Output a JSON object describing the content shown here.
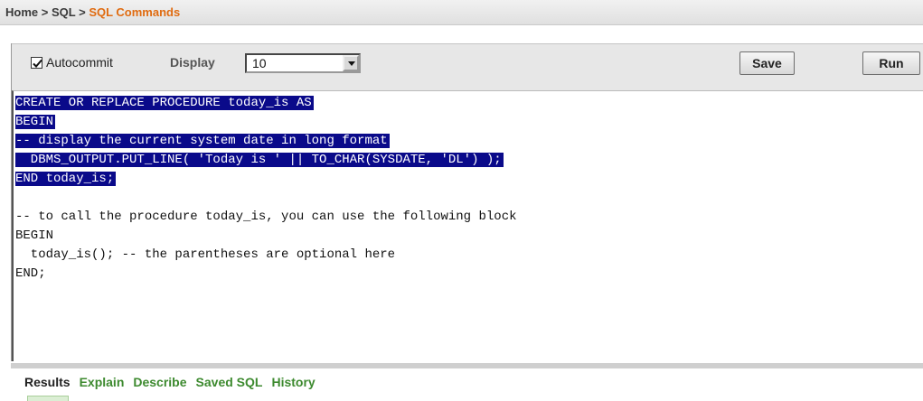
{
  "breadcrumb": {
    "items": [
      "Home",
      "SQL"
    ],
    "separator": ">",
    "current": "SQL Commands"
  },
  "toolbar": {
    "autocommit_label": "Autocommit",
    "autocommit_checked": true,
    "display_label": "Display",
    "display_value": "10",
    "save_label": "Save",
    "run_label": "Run"
  },
  "editor": {
    "lines": [
      {
        "text": "CREATE OR REPLACE PROCEDURE today_is AS",
        "selected": true
      },
      {
        "text": "BEGIN",
        "selected": true
      },
      {
        "text": "-- display the current system date in long format",
        "selected": true
      },
      {
        "text": "  DBMS_OUTPUT.PUT_LINE( 'Today is ' || TO_CHAR(SYSDATE, 'DL') );",
        "selected": true
      },
      {
        "text": "END today_is;",
        "selected": true
      },
      {
        "text": "",
        "selected": false
      },
      {
        "text": "-- to call the procedure today_is, you can use the following block",
        "selected": false
      },
      {
        "text": "BEGIN",
        "selected": false
      },
      {
        "text": "  today_is(); -- the parentheses are optional here",
        "selected": false
      },
      {
        "text": "END;",
        "selected": false
      }
    ]
  },
  "results_tabs": {
    "items": [
      {
        "label": "Results",
        "active": true
      },
      {
        "label": "Explain",
        "active": false
      },
      {
        "label": "Describe",
        "active": false
      },
      {
        "label": "Saved SQL",
        "active": false
      },
      {
        "label": "History",
        "active": false
      }
    ]
  },
  "colors": {
    "breadcrumb_current": "#e06b10",
    "selection_bg": "#0a0a8a",
    "selection_fg": "#ffffff",
    "tab_link": "#3d8a2f"
  },
  "icons": {
    "checkbox_check": "check-icon",
    "select_arrow": "chevron-down-icon"
  }
}
